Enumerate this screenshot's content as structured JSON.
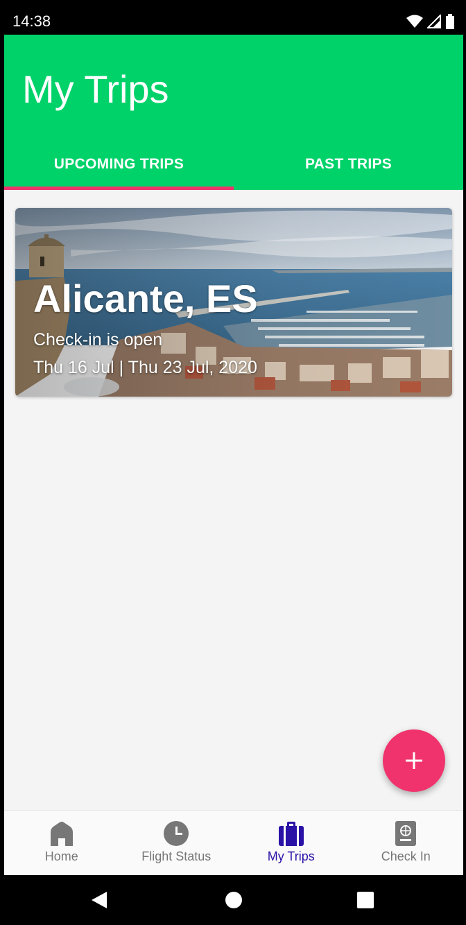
{
  "status_bar": {
    "time": "14:38",
    "icons": [
      "wifi-icon",
      "signal-icon",
      "battery-icon"
    ]
  },
  "header": {
    "title": "My Trips",
    "background_color": "#00d26a",
    "tabs": [
      {
        "label": "UPCOMING TRIPS",
        "active": true
      },
      {
        "label": "PAST TRIPS",
        "active": false
      }
    ],
    "tab_indicator_color": "#f0336c"
  },
  "trips": [
    {
      "destination": "Alicante, ES",
      "status": "Check-in is open",
      "dates": "Thu 16 Jul | Thu 23 Jul, 2020"
    }
  ],
  "fab": {
    "icon": "plus-icon",
    "color": "#f0336c"
  },
  "bottom_nav": {
    "items": [
      {
        "label": "Home",
        "icon": "home-icon",
        "active": false
      },
      {
        "label": "Flight Status",
        "icon": "clock-icon",
        "active": false
      },
      {
        "label": "My Trips",
        "icon": "suitcase-icon",
        "active": true
      },
      {
        "label": "Check In",
        "icon": "passport-icon",
        "active": false
      }
    ],
    "active_color": "#2a12a6",
    "inactive_color": "#777777"
  },
  "system_nav": {
    "icons": [
      "back-icon",
      "home-circle-icon",
      "recents-icon"
    ]
  }
}
